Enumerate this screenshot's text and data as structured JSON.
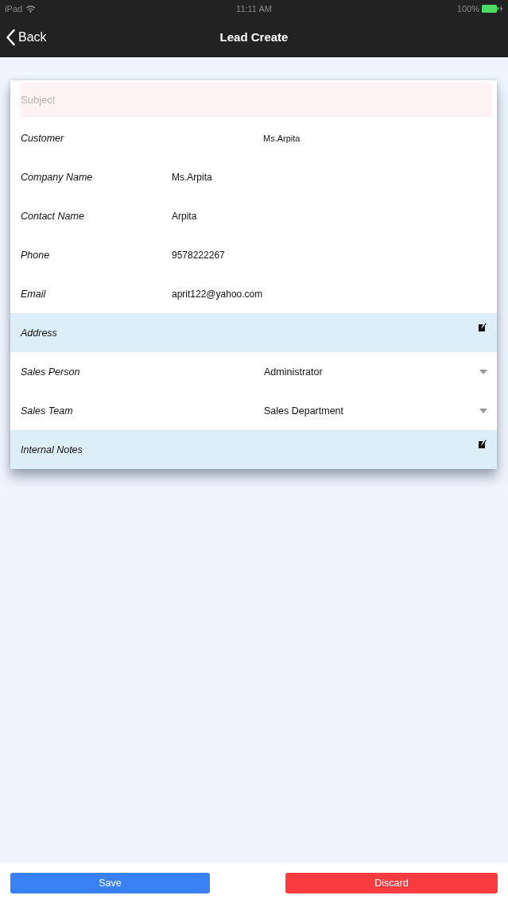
{
  "status_bar": {
    "device": "iPad",
    "time": "11:11 AM",
    "battery": "100%"
  },
  "nav_bar": {
    "back": "Back",
    "title": "Lead Create"
  },
  "subject": {
    "placeholder": "Subject"
  },
  "fields": [
    {
      "kind": "relation",
      "label": "Customer",
      "value": "Ms.Arpita"
    },
    {
      "kind": "text",
      "label": "Company Name",
      "value": "Ms.Arpita"
    },
    {
      "kind": "text",
      "label": "Contact Name",
      "value": "Arpita"
    },
    {
      "kind": "text",
      "label": "Phone",
      "value": "9578222267"
    },
    {
      "kind": "text",
      "label": "Email",
      "value": "aprit122@yahoo.com"
    },
    {
      "kind": "note",
      "label": "Address"
    },
    {
      "kind": "select",
      "label": "Sales Person",
      "value": "Administrator"
    },
    {
      "kind": "select",
      "label": "Sales Team",
      "value": "Sales Department"
    },
    {
      "kind": "note",
      "label": "Internal Notes"
    }
  ],
  "buttons": [
    {
      "kind": "save",
      "label": "Save"
    },
    {
      "kind": "discard",
      "label": "Discard"
    }
  ]
}
